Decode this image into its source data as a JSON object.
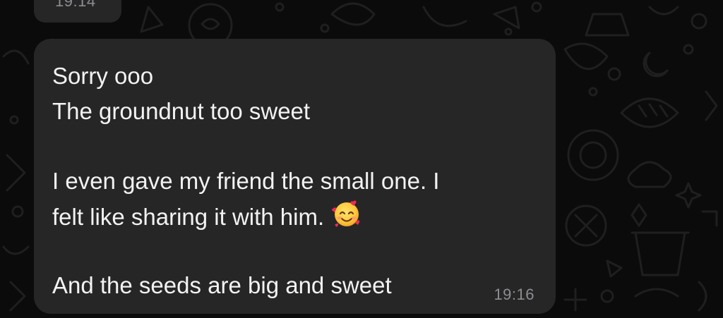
{
  "chat": {
    "previous_message": {
      "time": "19:14"
    },
    "message": {
      "lines": [
        "Sorry ooo",
        "The groundnut too sweet",
        "",
        "I even gave my friend the small one. I",
        "felt like sharing it with him.",
        "",
        "And the seeds are big and sweet"
      ],
      "emoji": "smiling-face-with-hearts-icon",
      "time": "19:16"
    }
  },
  "colors": {
    "background": "#0b0b0b",
    "bubble": "#262627",
    "text": "#f2f2f2",
    "timestamp": "#8d8d92",
    "doodle": "#222222"
  }
}
